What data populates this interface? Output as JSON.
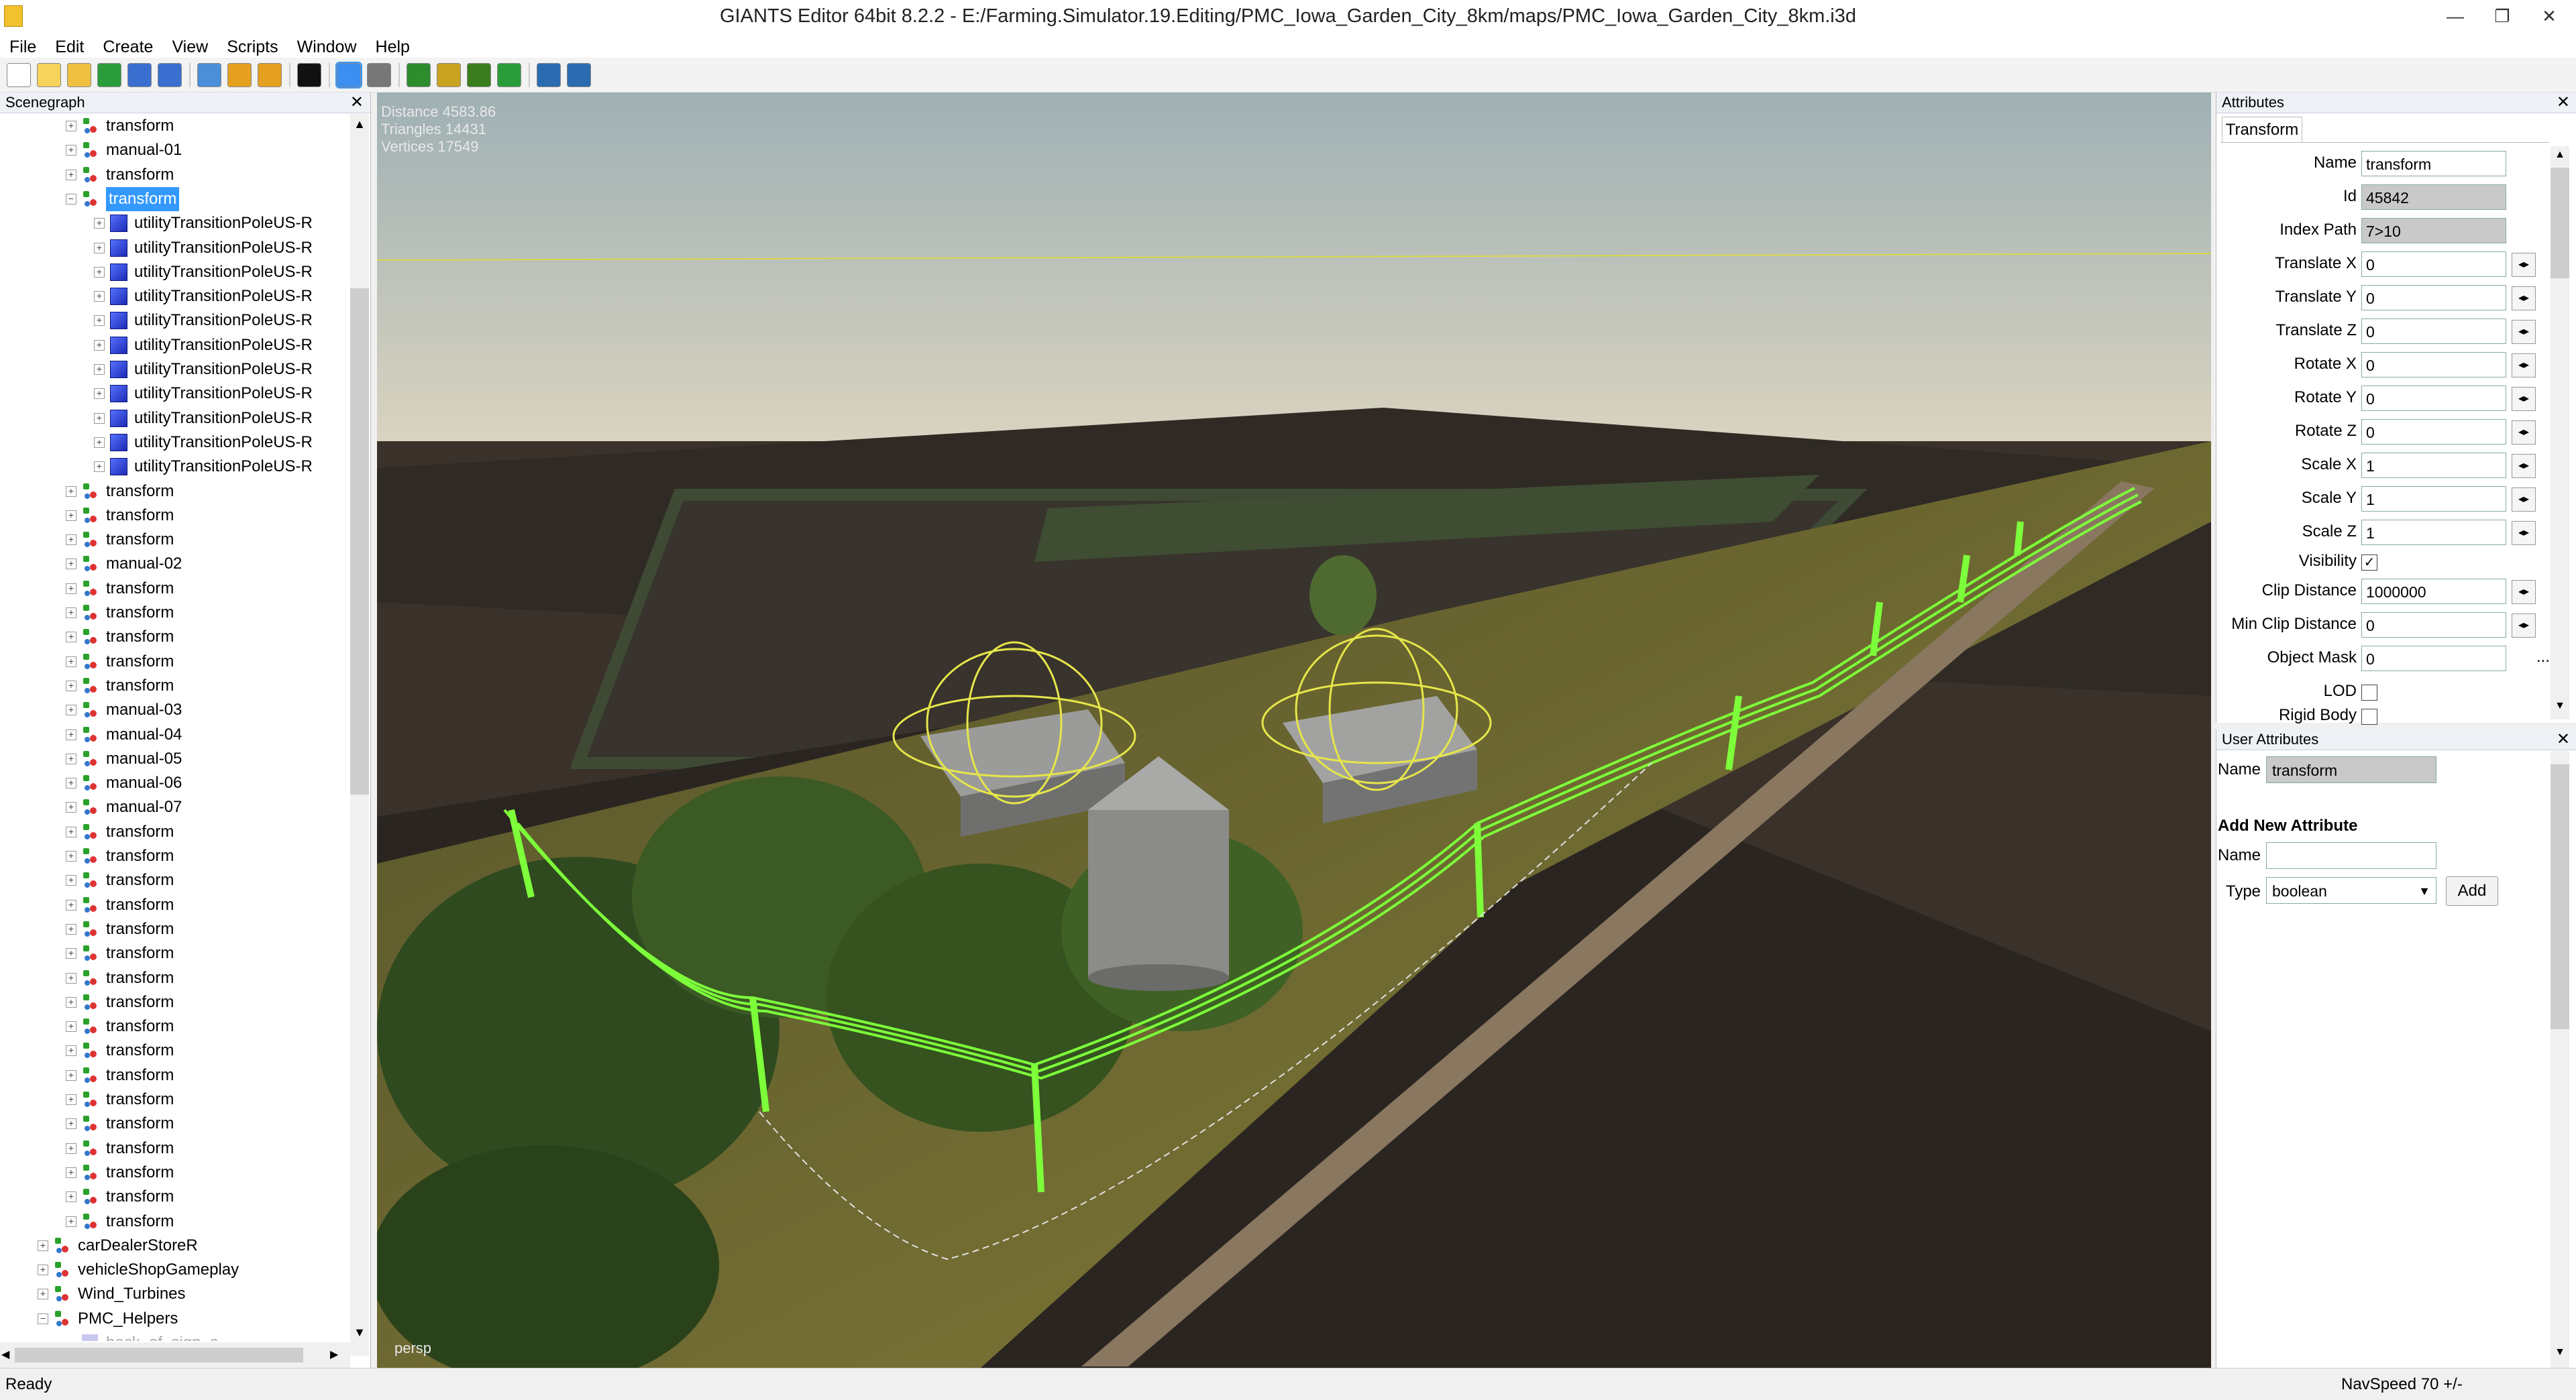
{
  "window": {
    "title": "GIANTS Editor 64bit 8.2.2 - E:/Farming.Simulator.19.Editing/PMC_Iowa_Garden_City_8km/maps/PMC_Iowa_Garden_City_8km.i3d",
    "minimize": "—",
    "restore": "❐",
    "close": "✕"
  },
  "menu": [
    "File",
    "Edit",
    "Create",
    "View",
    "Scripts",
    "Window",
    "Help"
  ],
  "toolbar": {
    "icons": [
      "new-file-icon",
      "open-file-icon",
      "edit-icon",
      "refresh-icon",
      "save-icon",
      "save-as-icon",
      "import-icon",
      "undo-icon",
      "redo-icon",
      "play-icon",
      "select-mode-icon",
      "magnet-icon",
      "terrain-sculpt-icon",
      "terrain-paint-icon",
      "foliage-paint-icon",
      "spline-icon",
      "settings-icon",
      "plugin-icon"
    ]
  },
  "scenegraph": {
    "title": "Scenegraph",
    "close": "✕",
    "rows": [
      {
        "indent": 1,
        "icon": "transform",
        "label": "transform",
        "exp": "+"
      },
      {
        "indent": 1,
        "icon": "transform",
        "label": "manual-01",
        "exp": "+"
      },
      {
        "indent": 1,
        "icon": "transform",
        "label": "transform",
        "exp": "+"
      },
      {
        "indent": 1,
        "icon": "transform",
        "label": "transform",
        "exp": "−",
        "selected": true
      },
      {
        "indent": 2,
        "icon": "cube",
        "label": "utilityTransitionPoleUS-R",
        "exp": "+"
      },
      {
        "indent": 2,
        "icon": "cube",
        "label": "utilityTransitionPoleUS-R",
        "exp": "+"
      },
      {
        "indent": 2,
        "icon": "cube",
        "label": "utilityTransitionPoleUS-R",
        "exp": "+"
      },
      {
        "indent": 2,
        "icon": "cube",
        "label": "utilityTransitionPoleUS-R",
        "exp": "+"
      },
      {
        "indent": 2,
        "icon": "cube",
        "label": "utilityTransitionPoleUS-R",
        "exp": "+"
      },
      {
        "indent": 2,
        "icon": "cube",
        "label": "utilityTransitionPoleUS-R",
        "exp": "+"
      },
      {
        "indent": 2,
        "icon": "cube",
        "label": "utilityTransitionPoleUS-R",
        "exp": "+"
      },
      {
        "indent": 2,
        "icon": "cube",
        "label": "utilityTransitionPoleUS-R",
        "exp": "+"
      },
      {
        "indent": 2,
        "icon": "cube",
        "label": "utilityTransitionPoleUS-R",
        "exp": "+"
      },
      {
        "indent": 2,
        "icon": "cube",
        "label": "utilityTransitionPoleUS-R",
        "exp": "+"
      },
      {
        "indent": 2,
        "icon": "cube",
        "label": "utilityTransitionPoleUS-R",
        "exp": "+"
      },
      {
        "indent": 1,
        "icon": "transform",
        "label": "transform",
        "exp": "+"
      },
      {
        "indent": 1,
        "icon": "transform",
        "label": "transform",
        "exp": "+"
      },
      {
        "indent": 1,
        "icon": "transform",
        "label": "transform",
        "exp": "+"
      },
      {
        "indent": 1,
        "icon": "transform",
        "label": "manual-02",
        "exp": "+"
      },
      {
        "indent": 1,
        "icon": "transform",
        "label": "transform",
        "exp": "+"
      },
      {
        "indent": 1,
        "icon": "transform",
        "label": "transform",
        "exp": "+"
      },
      {
        "indent": 1,
        "icon": "transform",
        "label": "transform",
        "exp": "+"
      },
      {
        "indent": 1,
        "icon": "transform",
        "label": "transform",
        "exp": "+"
      },
      {
        "indent": 1,
        "icon": "transform",
        "label": "transform",
        "exp": "+"
      },
      {
        "indent": 1,
        "icon": "transform",
        "label": "manual-03",
        "exp": "+"
      },
      {
        "indent": 1,
        "icon": "transform",
        "label": "manual-04",
        "exp": "+"
      },
      {
        "indent": 1,
        "icon": "transform",
        "label": "manual-05",
        "exp": "+"
      },
      {
        "indent": 1,
        "icon": "transform",
        "label": "manual-06",
        "exp": "+"
      },
      {
        "indent": 1,
        "icon": "transform",
        "label": "manual-07",
        "exp": "+"
      },
      {
        "indent": 1,
        "icon": "transform",
        "label": "transform",
        "exp": "+"
      },
      {
        "indent": 1,
        "icon": "transform",
        "label": "transform",
        "exp": "+"
      },
      {
        "indent": 1,
        "icon": "transform",
        "label": "transform",
        "exp": "+"
      },
      {
        "indent": 1,
        "icon": "transform",
        "label": "transform",
        "exp": "+"
      },
      {
        "indent": 1,
        "icon": "transform",
        "label": "transform",
        "exp": "+"
      },
      {
        "indent": 1,
        "icon": "transform",
        "label": "transform",
        "exp": "+"
      },
      {
        "indent": 1,
        "icon": "transform",
        "label": "transform",
        "exp": "+"
      },
      {
        "indent": 1,
        "icon": "transform",
        "label": "transform",
        "exp": "+"
      },
      {
        "indent": 1,
        "icon": "transform",
        "label": "transform",
        "exp": "+"
      },
      {
        "indent": 1,
        "icon": "transform",
        "label": "transform",
        "exp": "+"
      },
      {
        "indent": 1,
        "icon": "transform",
        "label": "transform",
        "exp": "+"
      },
      {
        "indent": 1,
        "icon": "transform",
        "label": "transform",
        "exp": "+"
      },
      {
        "indent": 1,
        "icon": "transform",
        "label": "transform",
        "exp": "+"
      },
      {
        "indent": 1,
        "icon": "transform",
        "label": "transform",
        "exp": "+"
      },
      {
        "indent": 1,
        "icon": "transform",
        "label": "transform",
        "exp": "+"
      },
      {
        "indent": 1,
        "icon": "transform",
        "label": "transform",
        "exp": "+"
      },
      {
        "indent": 1,
        "icon": "transform",
        "label": "transform",
        "exp": "+"
      },
      {
        "indent": 0,
        "icon": "transform",
        "label": "carDealerStoreR",
        "exp": "+"
      },
      {
        "indent": 0,
        "icon": "transform",
        "label": "vehicleShopGameplay",
        "exp": "+"
      },
      {
        "indent": 0,
        "icon": "transform",
        "label": "Wind_Turbines",
        "exp": "+"
      },
      {
        "indent": 0,
        "icon": "transform",
        "label": "PMC_Helpers",
        "exp": "−"
      },
      {
        "indent": 1,
        "icon": "cube-dim",
        "label": "back_of_sign_a",
        "exp": "",
        "dim": true
      }
    ],
    "scroll_up": "▲",
    "scroll_down": "▼",
    "scroll_left": "◀",
    "scroll_right": "▶"
  },
  "viewport": {
    "distance": "Distance 4583.86",
    "triangles": "Triangles 14431",
    "vertices": "Vertices 17549",
    "camera": "persp",
    "colors": {
      "wire": "#7dff3a",
      "selection": "#e6e64a",
      "sky": "#d7d2c2",
      "field": "#3a312a",
      "crop": "#6f6a2e"
    }
  },
  "attributes": {
    "title": "Attributes",
    "close": "✕",
    "tab": "Transform",
    "fields": [
      {
        "label": "Name",
        "value": "transform",
        "kind": "text"
      },
      {
        "label": "Id",
        "value": "45842",
        "kind": "ro"
      },
      {
        "label": "Index Path",
        "value": "7>10",
        "kind": "ro"
      },
      {
        "label": "Translate X",
        "value": "0",
        "kind": "spin"
      },
      {
        "label": "Translate Y",
        "value": "0",
        "kind": "spin"
      },
      {
        "label": "Translate Z",
        "value": "0",
        "kind": "spin"
      },
      {
        "label": "Rotate X",
        "value": "0",
        "kind": "spin"
      },
      {
        "label": "Rotate Y",
        "value": "0",
        "kind": "spin"
      },
      {
        "label": "Rotate Z",
        "value": "0",
        "kind": "spin"
      },
      {
        "label": "Scale X",
        "value": "1",
        "kind": "spin"
      },
      {
        "label": "Scale Y",
        "value": "1",
        "kind": "spin"
      },
      {
        "label": "Scale Z",
        "value": "1",
        "kind": "spin"
      },
      {
        "label": "Visibility",
        "value": "✓",
        "kind": "check"
      },
      {
        "label": "Clip Distance",
        "value": "1000000",
        "kind": "spin"
      },
      {
        "label": "Min Clip Distance",
        "value": "0",
        "kind": "spin"
      },
      {
        "label": "Object Mask",
        "value": "0",
        "kind": "dots"
      },
      {
        "label": "LOD",
        "value": "",
        "kind": "check"
      },
      {
        "label": "Rigid Body",
        "value": "",
        "kind": "check"
      }
    ],
    "spin_glyph": "◂▸",
    "dots": "...",
    "scroll_up": "▲",
    "scroll_down": "▼"
  },
  "user_attributes": {
    "title": "User Attributes",
    "close": "✕",
    "name_label": "Name",
    "name_value": "transform",
    "add_heading": "Add New Attribute",
    "new_name_label": "Name",
    "new_name_value": "",
    "type_label": "Type",
    "type_value": "boolean",
    "add_button": "Add",
    "scroll_down": "▼"
  },
  "status": {
    "left": "Ready",
    "right": "NavSpeed 70 +/-"
  }
}
